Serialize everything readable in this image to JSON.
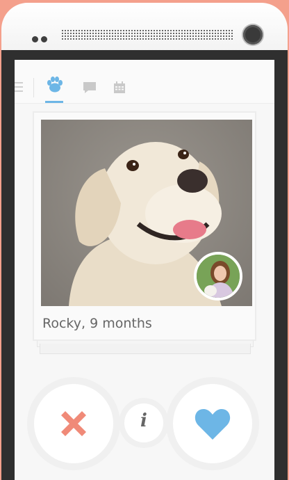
{
  "profile": {
    "name_age": "Rocky, 9 months"
  },
  "nav": {
    "icons": [
      "menu-icon",
      "paw-icon",
      "chat-icon",
      "calendar-icon"
    ],
    "active": "paw-icon"
  },
  "actions": {
    "dislike_icon": "close-icon",
    "info_label": "i",
    "like_icon": "heart-icon"
  },
  "colors": {
    "accent_blue": "#6db6e6",
    "dislike_red": "#f08a78",
    "background_peach": "#f4a08c"
  }
}
